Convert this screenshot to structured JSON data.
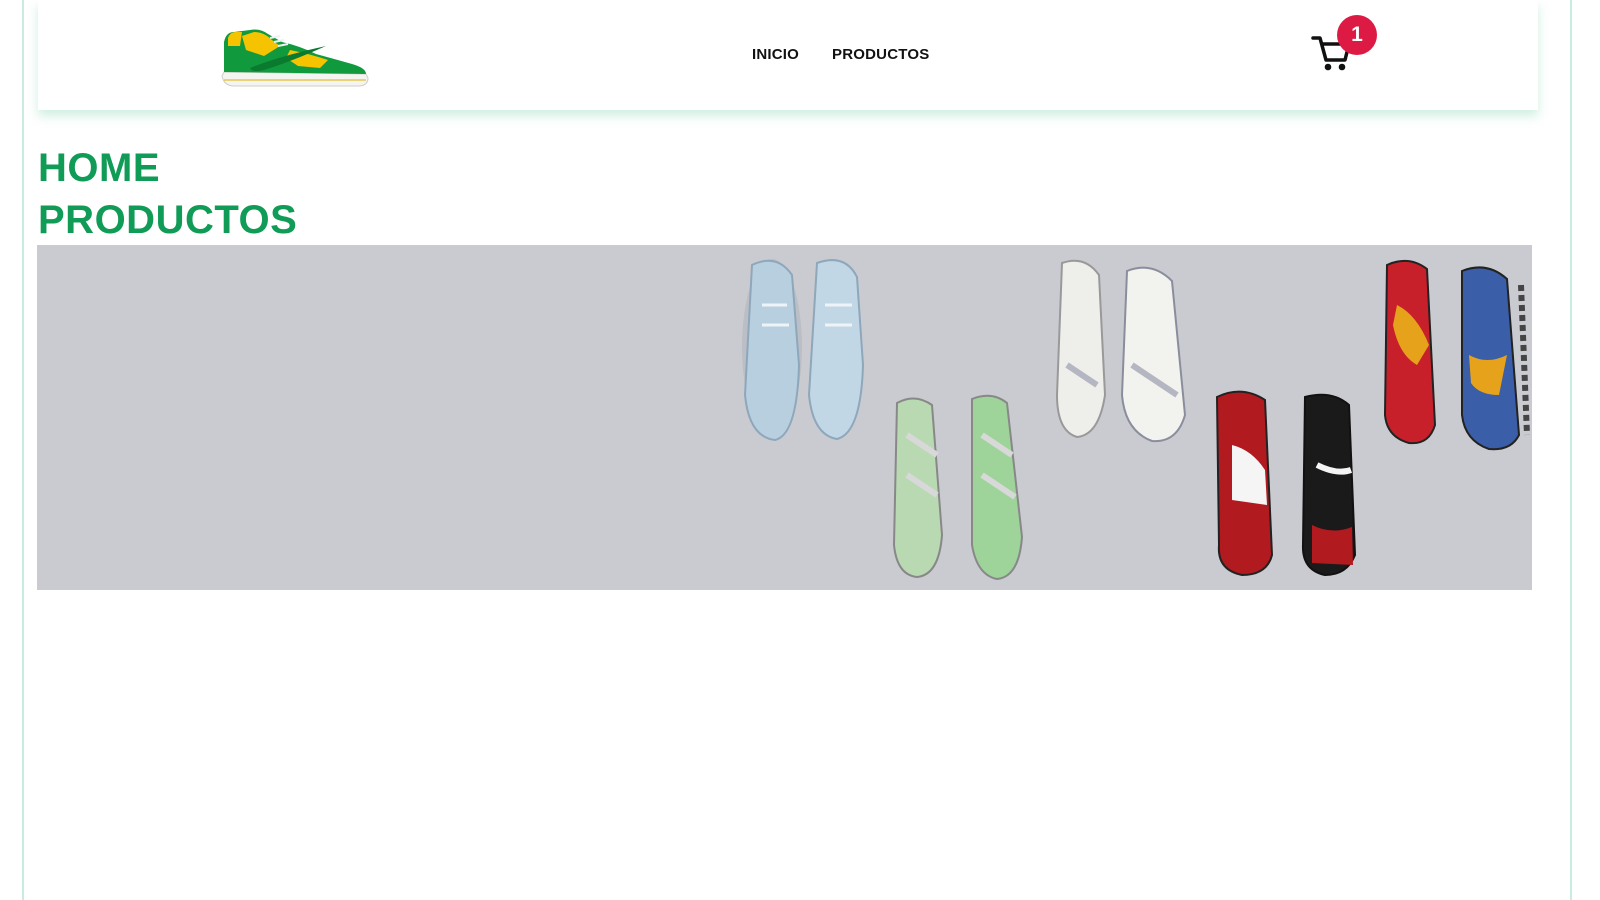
{
  "navbar": {
    "logo_alt": "green and yellow sneaker logo",
    "links": [
      {
        "label": "INICIO"
      },
      {
        "label": "PRODUCTOS"
      }
    ],
    "cart": {
      "count": "1",
      "icon": "cart-icon"
    }
  },
  "main": {
    "headings": [
      "HOME",
      "PRODUCTOS"
    ],
    "hero": {
      "alt": "Sneakers collection banner",
      "background": "#cacbd1"
    }
  },
  "colors": {
    "accent_green": "#109b57",
    "badge_red": "#dc1a44",
    "text_dark": "#111111"
  }
}
